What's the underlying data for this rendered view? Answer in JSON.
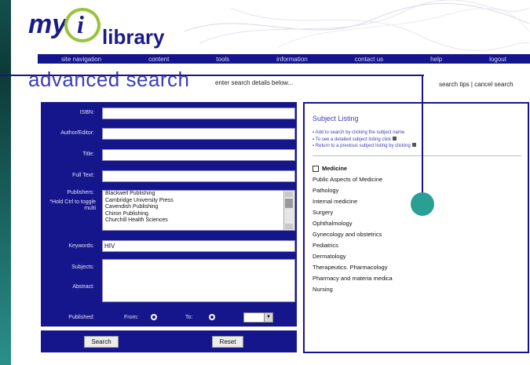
{
  "logo": {
    "my": "my",
    "i": "i",
    "library": "library"
  },
  "nav": [
    "site navigation",
    "content",
    "tools",
    "information",
    "contact us",
    "help",
    "logout"
  ],
  "page_title": "advanced search",
  "subtitle": "enter search details below...",
  "top_links": "search tips | cancel search",
  "form": {
    "labels": {
      "isbn": "ISBN:",
      "author": "Author/Editor:",
      "title": "Title:",
      "fulltext": "Full Text:",
      "publishers": "Publishers:",
      "publishers_note": "*Hold Ctrl to toggle multi",
      "keywords": "Keywords:",
      "subjects": "Subjects:",
      "abstract": "Abstract:",
      "published": "Published:",
      "from": "From:",
      "to": "To:"
    },
    "publishers": [
      "Blackwell Publishing",
      "Cambridge University Press",
      "Cavendish Publishing",
      "Chiron Publishing",
      "Churchill Health Sciences"
    ],
    "keywords_value": "HIV",
    "search_button": "Search",
    "reset_button": "Reset"
  },
  "subjects": {
    "heading": "Subject Listing",
    "tips": [
      "Add to search by clicking the subject name",
      "To see a detailed subject listing click",
      "Return to a previous subject listing by clicking"
    ],
    "items": [
      "Medicine",
      "Public Aspects of Medicine",
      "Pathology",
      "Internal medicine",
      "Surgery",
      "Ophthalmology",
      "Gynecology and obstetrics",
      "Pediatrics",
      "Dermatology",
      "Therapeutics. Pharmacology",
      "Pharmacy and materia medica",
      "Nursing"
    ]
  }
}
